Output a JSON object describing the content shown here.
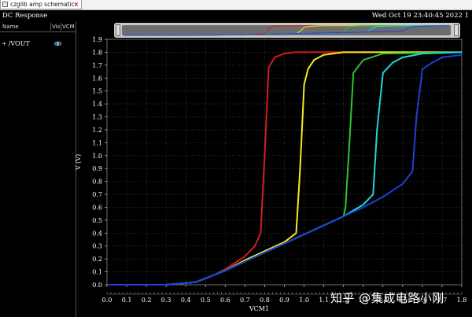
{
  "tab": {
    "label": "czglib amp schematic",
    "close": "×",
    "icon": "schematic-tab-icon"
  },
  "window": {
    "title": "DC Response",
    "timestamp": "Wed Oct 19 23:40:45 2022   1"
  },
  "panel": {
    "columns": [
      "Name",
      "Vis",
      "VCM"
    ],
    "traces": [
      {
        "expand": "+",
        "name": "/VOUT",
        "visible_icon": "eye-icon"
      }
    ]
  },
  "watermark": "知乎 @集成电路小刚",
  "colors": {
    "red": "#d01e1e",
    "yellow": "#f2ec1c",
    "green": "#2fc42f",
    "cyan": "#22d6d6",
    "blue": "#1f3fd8",
    "grid": "#4a4a4a",
    "background": "#000000",
    "text": "#ffffff"
  },
  "chart_data": {
    "type": "line",
    "title": "",
    "xlabel": "VCM1",
    "ylabel": "V (V)",
    "xlim": [
      0.0,
      1.8
    ],
    "ylim": [
      0.0,
      1.9
    ],
    "x_ticks": [
      "0.0",
      "0.1",
      "0.2",
      "0.3",
      "0.4",
      "0.5",
      "0.6",
      "0.7",
      "0.8",
      "0.9",
      "1.0",
      "1.1",
      "1.2",
      "1.3",
      "1.4",
      "1.5",
      "1.6",
      "1.7",
      "1.8"
    ],
    "y_ticks": [
      "0.0",
      "0.1",
      "0.2",
      "0.3",
      "0.4",
      "0.5",
      "0.6",
      "0.7",
      "0.8",
      "0.9",
      "1.0",
      "1.1",
      "1.2",
      "1.3",
      "1.4",
      "1.5",
      "1.6",
      "1.7",
      "1.8",
      "1.9"
    ],
    "grid": true,
    "series": [
      {
        "color": "#d01e1e",
        "x": [
          0.0,
          0.3,
          0.45,
          0.5,
          0.55,
          0.6,
          0.65,
          0.7,
          0.75,
          0.78,
          0.8,
          0.82,
          0.85,
          0.9,
          0.95,
          1.0,
          1.8
        ],
        "y": [
          0.0,
          0.0,
          0.02,
          0.05,
          0.08,
          0.12,
          0.17,
          0.22,
          0.3,
          0.4,
          1.0,
          1.68,
          1.76,
          1.79,
          1.8,
          1.8,
          1.8
        ]
      },
      {
        "color": "#f2ec1c",
        "x": [
          0.0,
          0.3,
          0.45,
          0.5,
          0.6,
          0.7,
          0.8,
          0.9,
          0.96,
          0.98,
          1.0,
          1.02,
          1.05,
          1.1,
          1.2,
          1.8
        ],
        "y": [
          0.0,
          0.0,
          0.02,
          0.05,
          0.11,
          0.19,
          0.26,
          0.33,
          0.4,
          0.9,
          1.55,
          1.67,
          1.74,
          1.78,
          1.8,
          1.8
        ]
      },
      {
        "color": "#2fc42f",
        "x": [
          0.0,
          0.3,
          0.45,
          0.5,
          0.6,
          0.7,
          0.8,
          0.9,
          1.0,
          1.1,
          1.2,
          1.21,
          1.23,
          1.25,
          1.3,
          1.4,
          1.8
        ],
        "y": [
          0.0,
          0.0,
          0.02,
          0.05,
          0.11,
          0.18,
          0.25,
          0.32,
          0.39,
          0.46,
          0.53,
          0.6,
          1.1,
          1.64,
          1.74,
          1.79,
          1.8
        ]
      },
      {
        "color": "#22d6d6",
        "x": [
          0.0,
          0.3,
          0.45,
          0.5,
          0.6,
          0.7,
          0.8,
          0.9,
          1.0,
          1.1,
          1.2,
          1.3,
          1.35,
          1.37,
          1.4,
          1.45,
          1.5,
          1.6,
          1.8
        ],
        "y": [
          0.0,
          0.0,
          0.02,
          0.05,
          0.11,
          0.18,
          0.25,
          0.32,
          0.39,
          0.46,
          0.53,
          0.62,
          0.7,
          1.2,
          1.64,
          1.72,
          1.76,
          1.79,
          1.8
        ]
      },
      {
        "color": "#1f3fd8",
        "x": [
          0.0,
          0.3,
          0.45,
          0.5,
          0.6,
          0.7,
          0.8,
          0.9,
          1.0,
          1.1,
          1.2,
          1.3,
          1.4,
          1.5,
          1.55,
          1.57,
          1.6,
          1.65,
          1.7,
          1.8
        ],
        "y": [
          0.0,
          0.0,
          0.02,
          0.05,
          0.11,
          0.18,
          0.25,
          0.32,
          0.39,
          0.46,
          0.53,
          0.6,
          0.68,
          0.78,
          0.88,
          1.3,
          1.67,
          1.72,
          1.76,
          1.78
        ]
      }
    ]
  }
}
